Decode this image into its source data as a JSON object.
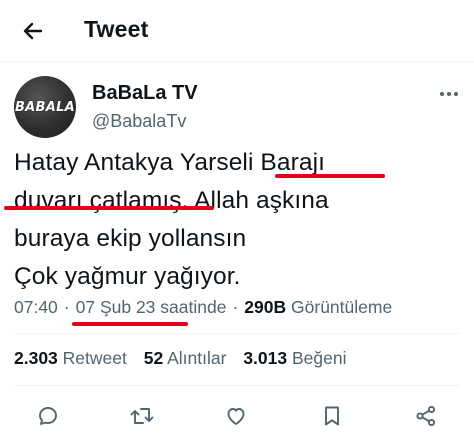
{
  "header": {
    "title": "Tweet"
  },
  "author": {
    "display_name": "BaBaLa TV",
    "handle": "@BabalaTv",
    "avatar_text": "BABALA"
  },
  "tweet": {
    "lines": [
      "Hatay Antakya Yarseli Barajı",
      "duvarı çatlamış. Allah aşkına",
      "buraya ekip yollansın",
      "Çok yağmur yağıyor."
    ]
  },
  "meta": {
    "time": "07:40",
    "separator": "·",
    "date": "07 Şub 23",
    "suffix": "saatinde",
    "views_count": "290B",
    "views_label": "Görüntüleme"
  },
  "stats": {
    "retweets_count": "2.303",
    "retweets_label": "Retweet",
    "quotes_count": "52",
    "quotes_label": "Alıntılar",
    "likes_count": "3.013",
    "likes_label": "Beğeni"
  },
  "icons": {
    "back": "arrow-left-icon",
    "more": "more-icon",
    "reply": "reply-icon",
    "retweet": "retweet-icon",
    "like": "heart-icon",
    "bookmark": "bookmark-icon",
    "share": "share-icon"
  },
  "colors": {
    "text": "#0f1419",
    "secondary": "#536471",
    "annotation": "#e0001b",
    "divider": "#eff3f4"
  }
}
